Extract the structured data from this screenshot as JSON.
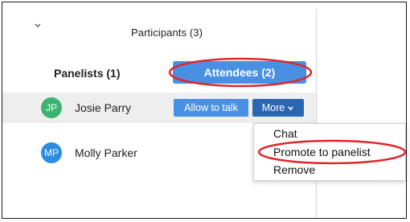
{
  "header": {
    "title": "Participants (3)",
    "collapse_icon": "chevron-down-icon"
  },
  "tabs": {
    "panelists": "Panelists (1)",
    "attendees": "Attendees (2)"
  },
  "attendees": [
    {
      "initials": "JP",
      "name": "Josie Parry",
      "avatar_color": "#3cb371",
      "allow_label": "Allow to talk",
      "more_label": "More"
    },
    {
      "initials": "MP",
      "name": "Molly Parker",
      "avatar_color": "#2d8cdb"
    }
  ],
  "more_menu": {
    "items": [
      "Chat",
      "Promote to panelist",
      "Remove"
    ]
  },
  "colors": {
    "accent_blue": "#4a90e2",
    "dark_blue": "#2a67b2",
    "annotation_red": "#e0262b",
    "row_highlight": "#eeeeee"
  }
}
